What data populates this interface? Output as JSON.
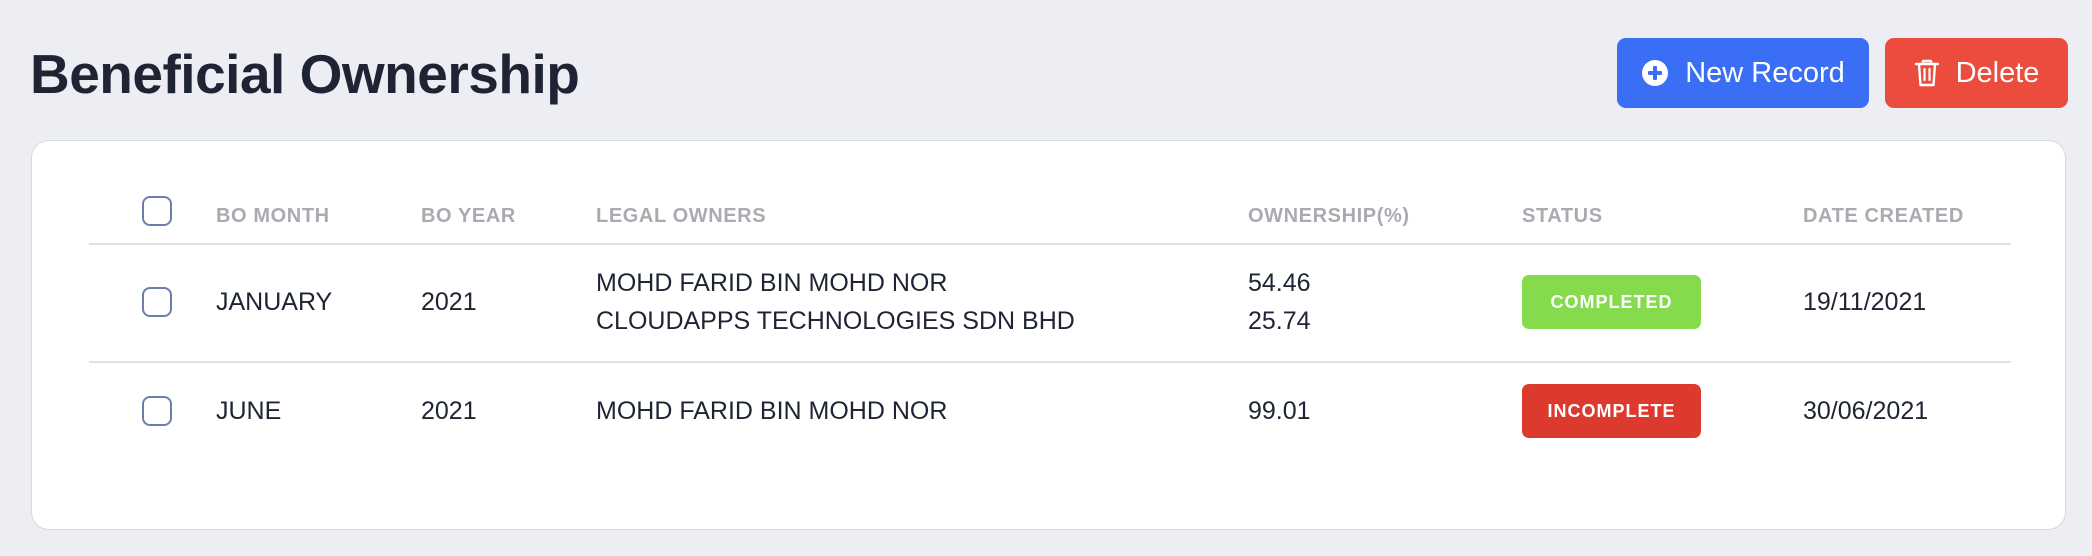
{
  "header": {
    "title": "Beneficial Ownership",
    "new_record_label": "New Record",
    "delete_label": "Delete"
  },
  "colors": {
    "primary": "#3a6ff5",
    "danger": "#ec4c3e",
    "completed": "#86db4c",
    "incomplete": "#dc3a2f"
  },
  "table": {
    "columns": [
      "BO MONTH",
      "BO YEAR",
      "LEGAL OWNERS",
      "OWNERSHIP(%)",
      "STATUS",
      "DATE CREATED"
    ],
    "rows": [
      {
        "month": "JANUARY",
        "year": "2021",
        "owners": [
          "MOHD FARID BIN MOHD NOR",
          "CLOUDAPPS TECHNOLOGIES SDN BHD"
        ],
        "ownership": [
          "54.46",
          "25.74"
        ],
        "status": "COMPLETED",
        "date_created": "19/11/2021"
      },
      {
        "month": "JUNE",
        "year": "2021",
        "owners": [
          "MOHD FARID BIN MOHD NOR"
        ],
        "ownership": [
          "99.01"
        ],
        "status": "INCOMPLETE",
        "date_created": "30/06/2021"
      }
    ]
  }
}
